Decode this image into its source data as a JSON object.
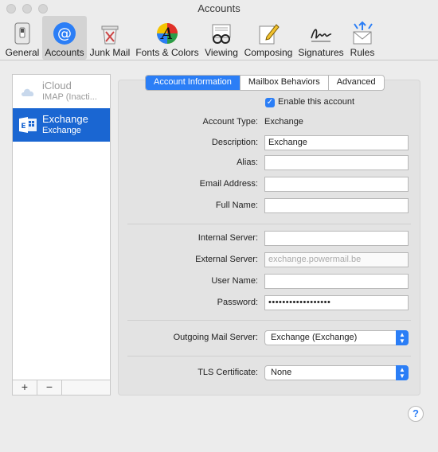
{
  "window": {
    "title": "Accounts"
  },
  "toolbar": {
    "items": [
      {
        "label": "General"
      },
      {
        "label": "Accounts"
      },
      {
        "label": "Junk Mail"
      },
      {
        "label": "Fonts & Colors"
      },
      {
        "label": "Viewing"
      },
      {
        "label": "Composing"
      },
      {
        "label": "Signatures"
      },
      {
        "label": "Rules"
      }
    ],
    "selected": "Accounts"
  },
  "sidebar": {
    "accounts": [
      {
        "name": "iCloud",
        "subtitle": "IMAP (Inacti...",
        "icon": "cloud-icon",
        "selected": false
      },
      {
        "name": "Exchange",
        "subtitle": "Exchange",
        "icon": "exchange-icon",
        "selected": true
      }
    ],
    "add_label": "+",
    "remove_label": "−"
  },
  "tabs": [
    {
      "label": "Account Information",
      "active": true
    },
    {
      "label": "Mailbox Behaviors",
      "active": false
    },
    {
      "label": "Advanced",
      "active": false
    }
  ],
  "form": {
    "enable_label": "Enable this account",
    "enable_checked": true,
    "account_type_label": "Account Type:",
    "account_type_value": "Exchange",
    "description_label": "Description:",
    "description_value": "Exchange",
    "alias_label": "Alias:",
    "alias_value": "",
    "email_label": "Email Address:",
    "email_value": "",
    "fullname_label": "Full Name:",
    "fullname_value": "",
    "internal_server_label": "Internal Server:",
    "internal_server_value": "",
    "external_server_label": "External Server:",
    "external_server_placeholder": "exchange.powermail.be",
    "username_label": "User Name:",
    "username_value": "",
    "password_label": "Password:",
    "password_value": "••••••••••••••••••",
    "outgoing_label": "Outgoing Mail Server:",
    "outgoing_value": "Exchange (Exchange)",
    "tls_label": "TLS Certificate:",
    "tls_value": "None"
  },
  "help_label": "?",
  "colors": {
    "accent": "#2b7ef6",
    "selection": "#1a66d2"
  }
}
